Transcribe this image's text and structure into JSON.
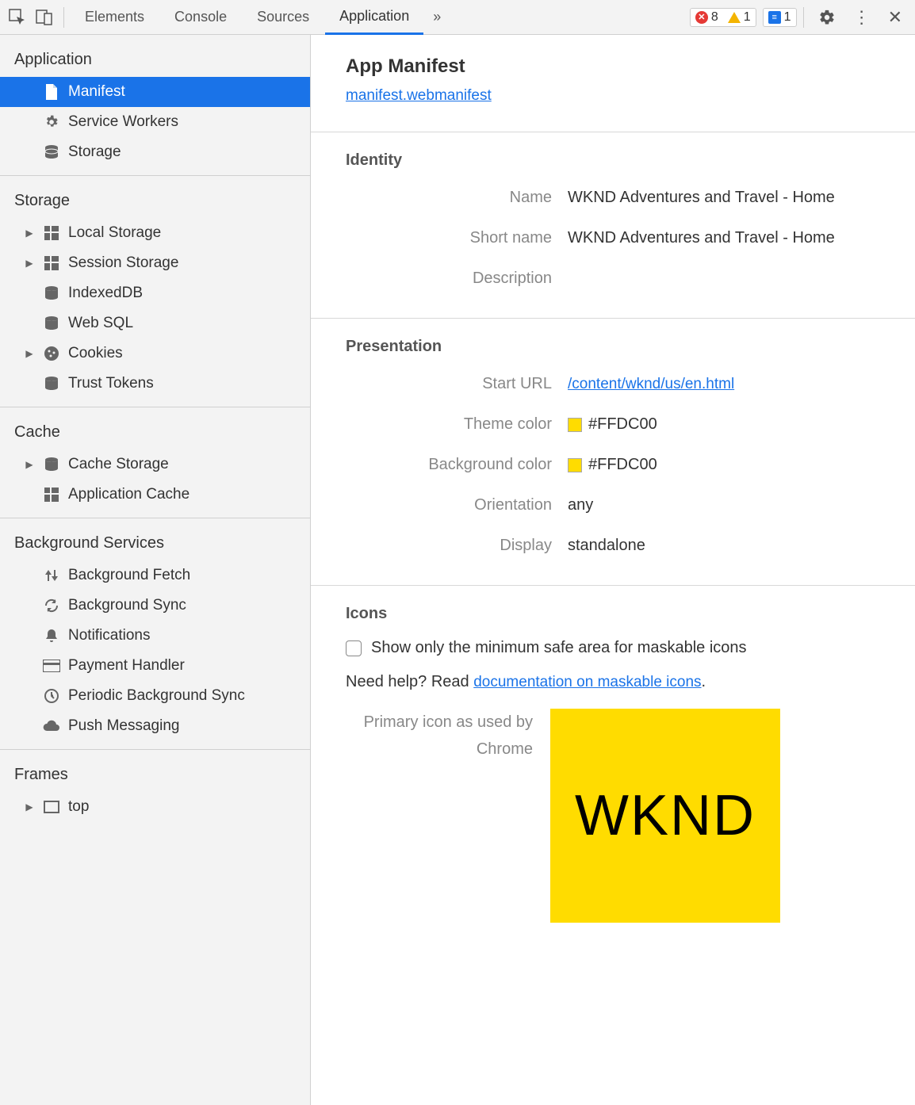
{
  "toolbar": {
    "tabs": [
      "Elements",
      "Console",
      "Sources",
      "Application"
    ],
    "active_tab": "Application",
    "more": "»",
    "error_count": "8",
    "warn_count": "1",
    "info_count": "1"
  },
  "sidebar": {
    "sections": [
      {
        "title": "Application",
        "items": [
          {
            "label": "Manifest",
            "icon": "file",
            "selected": true
          },
          {
            "label": "Service Workers",
            "icon": "gear"
          },
          {
            "label": "Storage",
            "icon": "db"
          }
        ]
      },
      {
        "title": "Storage",
        "items": [
          {
            "label": "Local Storage",
            "icon": "grid",
            "expand": true
          },
          {
            "label": "Session Storage",
            "icon": "grid",
            "expand": true
          },
          {
            "label": "IndexedDB",
            "icon": "db"
          },
          {
            "label": "Web SQL",
            "icon": "db"
          },
          {
            "label": "Cookies",
            "icon": "cookie",
            "expand": true
          },
          {
            "label": "Trust Tokens",
            "icon": "db"
          }
        ]
      },
      {
        "title": "Cache",
        "items": [
          {
            "label": "Cache Storage",
            "icon": "db",
            "expand": true
          },
          {
            "label": "Application Cache",
            "icon": "grid"
          }
        ]
      },
      {
        "title": "Background Services",
        "items": [
          {
            "label": "Background Fetch",
            "icon": "updown"
          },
          {
            "label": "Background Sync",
            "icon": "sync"
          },
          {
            "label": "Notifications",
            "icon": "bell"
          },
          {
            "label": "Payment Handler",
            "icon": "card"
          },
          {
            "label": "Periodic Background Sync",
            "icon": "clock"
          },
          {
            "label": "Push Messaging",
            "icon": "cloud"
          }
        ]
      },
      {
        "title": "Frames",
        "items": [
          {
            "label": "top",
            "icon": "frame",
            "expand": true
          }
        ]
      }
    ]
  },
  "manifest": {
    "page_title": "App Manifest",
    "file_link": "manifest.webmanifest",
    "identity": {
      "heading": "Identity",
      "name_label": "Name",
      "name_value": "WKND Adventures and Travel - Home",
      "shortname_label": "Short name",
      "shortname_value": "WKND Adventures and Travel - Home",
      "description_label": "Description",
      "description_value": ""
    },
    "presentation": {
      "heading": "Presentation",
      "starturl_label": "Start URL",
      "starturl_value": "/content/wknd/us/en.html",
      "themecolor_label": "Theme color",
      "themecolor_value": "#FFDC00",
      "bgcolor_label": "Background color",
      "bgcolor_value": "#FFDC00",
      "orientation_label": "Orientation",
      "orientation_value": "any",
      "display_label": "Display",
      "display_value": "standalone"
    },
    "icons": {
      "heading": "Icons",
      "checkbox_label": "Show only the minimum safe area for maskable icons",
      "help_prefix": "Need help? Read ",
      "help_link": "documentation on maskable icons",
      "help_suffix": ".",
      "primary_label_1": "Primary icon as used by",
      "primary_label_2": "Chrome",
      "icon_text": "WKND"
    }
  }
}
